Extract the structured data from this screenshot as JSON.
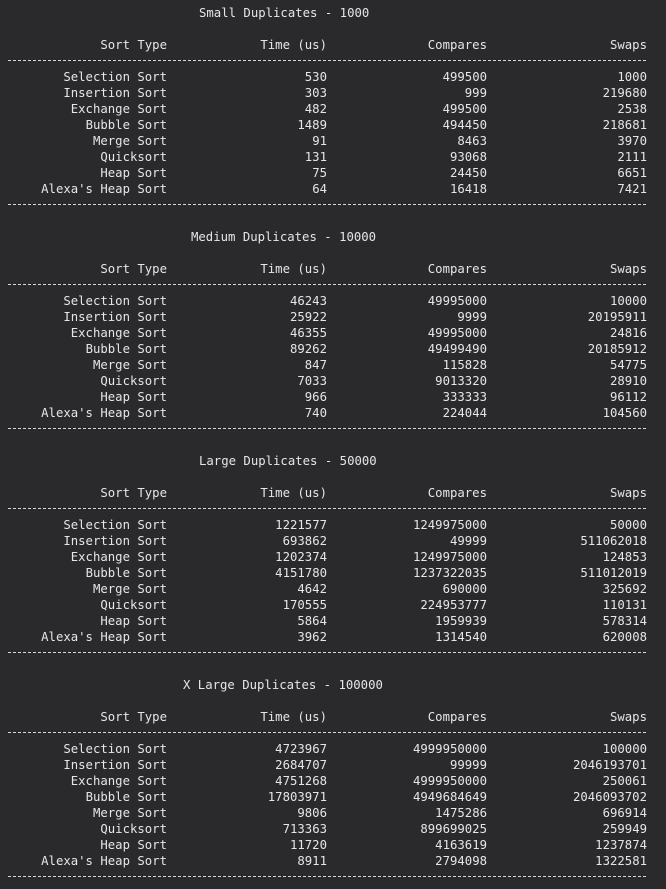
{
  "colors": {
    "background": "#2a292c",
    "text": "#e6e6e6"
  },
  "headers": {
    "sort_type": "Sort Type",
    "time": "Time (us)",
    "compares": "Compares",
    "swaps": "Swaps"
  },
  "sections": [
    {
      "title": "Small Duplicates - 1000",
      "rows": [
        {
          "name": "Selection Sort",
          "time": "530",
          "compares": "499500",
          "swaps": "1000"
        },
        {
          "name": "Insertion Sort",
          "time": "303",
          "compares": "999",
          "swaps": "219680"
        },
        {
          "name": "Exchange Sort",
          "time": "482",
          "compares": "499500",
          "swaps": "2538"
        },
        {
          "name": "Bubble Sort",
          "time": "1489",
          "compares": "494450",
          "swaps": "218681"
        },
        {
          "name": "Merge Sort",
          "time": "91",
          "compares": "8463",
          "swaps": "3970"
        },
        {
          "name": "Quicksort",
          "time": "131",
          "compares": "93068",
          "swaps": "2111"
        },
        {
          "name": "Heap Sort",
          "time": "75",
          "compares": "24450",
          "swaps": "6651"
        },
        {
          "name": "Alexa's Heap Sort",
          "time": "64",
          "compares": "16418",
          "swaps": "7421"
        }
      ]
    },
    {
      "title": "Medium Duplicates - 10000",
      "rows": [
        {
          "name": "Selection Sort",
          "time": "46243",
          "compares": "49995000",
          "swaps": "10000"
        },
        {
          "name": "Insertion Sort",
          "time": "25922",
          "compares": "9999",
          "swaps": "20195911"
        },
        {
          "name": "Exchange Sort",
          "time": "46355",
          "compares": "49995000",
          "swaps": "24816"
        },
        {
          "name": "Bubble Sort",
          "time": "89262",
          "compares": "49499490",
          "swaps": "20185912"
        },
        {
          "name": "Merge Sort",
          "time": "847",
          "compares": "115828",
          "swaps": "54775"
        },
        {
          "name": "Quicksort",
          "time": "7033",
          "compares": "9013320",
          "swaps": "28910"
        },
        {
          "name": "Heap Sort",
          "time": "966",
          "compares": "333333",
          "swaps": "96112"
        },
        {
          "name": "Alexa's Heap Sort",
          "time": "740",
          "compares": "224044",
          "swaps": "104560"
        }
      ]
    },
    {
      "title": "Large Duplicates - 50000",
      "rows": [
        {
          "name": "Selection Sort",
          "time": "1221577",
          "compares": "1249975000",
          "swaps": "50000"
        },
        {
          "name": "Insertion Sort",
          "time": "693862",
          "compares": "49999",
          "swaps": "511062018"
        },
        {
          "name": "Exchange Sort",
          "time": "1202374",
          "compares": "1249975000",
          "swaps": "124853"
        },
        {
          "name": "Bubble Sort",
          "time": "4151780",
          "compares": "1237322035",
          "swaps": "511012019"
        },
        {
          "name": "Merge Sort",
          "time": "4642",
          "compares": "690000",
          "swaps": "325692"
        },
        {
          "name": "Quicksort",
          "time": "170555",
          "compares": "224953777",
          "swaps": "110131"
        },
        {
          "name": "Heap Sort",
          "time": "5864",
          "compares": "1959939",
          "swaps": "578314"
        },
        {
          "name": "Alexa's Heap Sort",
          "time": "3962",
          "compares": "1314540",
          "swaps": "620008"
        }
      ]
    },
    {
      "title": "X Large Duplicates - 100000",
      "rows": [
        {
          "name": "Selection Sort",
          "time": "4723967",
          "compares": "4999950000",
          "swaps": "100000"
        },
        {
          "name": "Insertion Sort",
          "time": "2684707",
          "compares": "99999",
          "swaps": "2046193701"
        },
        {
          "name": "Exchange Sort",
          "time": "4751268",
          "compares": "4999950000",
          "swaps": "250061"
        },
        {
          "name": "Bubble Sort",
          "time": "17803971",
          "compares": "4949684649",
          "swaps": "2046093702"
        },
        {
          "name": "Merge Sort",
          "time": "9806",
          "compares": "1475286",
          "swaps": "696914"
        },
        {
          "name": "Quicksort",
          "time": "713363",
          "compares": "899699025",
          "swaps": "259949"
        },
        {
          "name": "Heap Sort",
          "time": "11720",
          "compares": "4163619",
          "swaps": "1237874"
        },
        {
          "name": "Alexa's Heap Sort",
          "time": "8911",
          "compares": "2794098",
          "swaps": "1322581"
        }
      ]
    }
  ]
}
